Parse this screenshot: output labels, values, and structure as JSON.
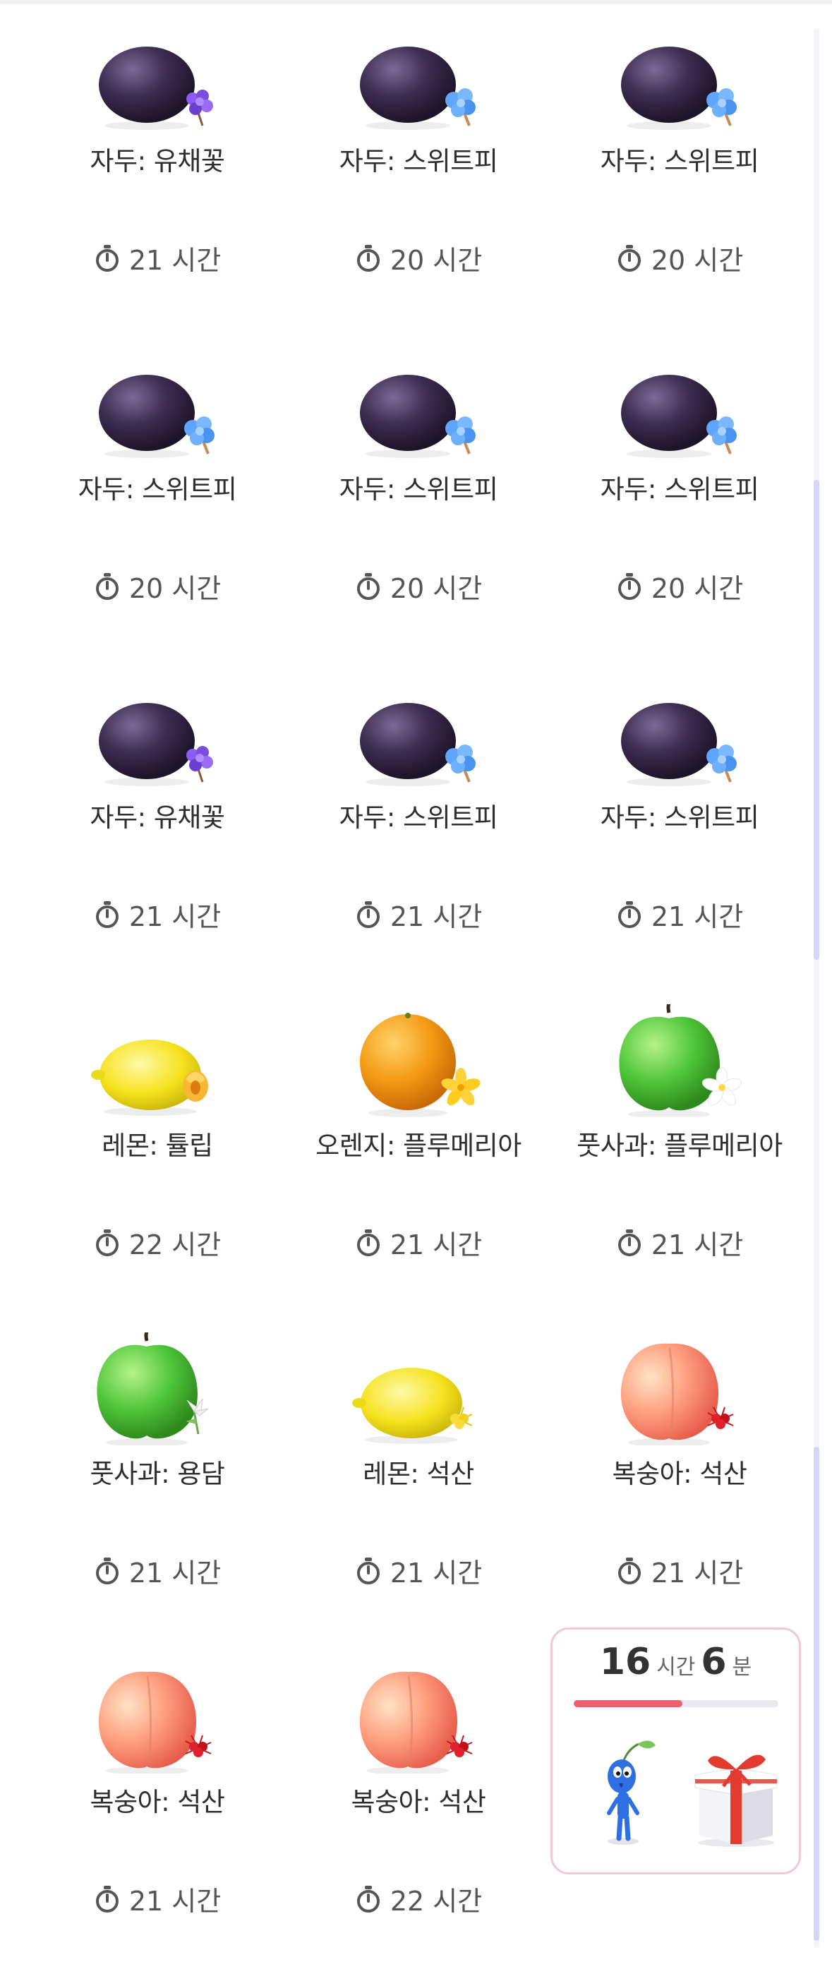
{
  "items": [
    {
      "fruit": "plum",
      "flower": "rapeseed",
      "label": "자두: 유채꽃",
      "time": "21 시간"
    },
    {
      "fruit": "plum",
      "flower": "sweetpea",
      "label": "자두: 스위트피",
      "time": "20 시간"
    },
    {
      "fruit": "plum",
      "flower": "sweetpea",
      "label": "자두: 스위트피",
      "time": "20 시간"
    },
    {
      "fruit": "plum",
      "flower": "sweetpea",
      "label": "자두: 스위트피",
      "time": "20 시간"
    },
    {
      "fruit": "plum",
      "flower": "sweetpea",
      "label": "자두: 스위트피",
      "time": "20 시간"
    },
    {
      "fruit": "plum",
      "flower": "sweetpea",
      "label": "자두: 스위트피",
      "time": "20 시간"
    },
    {
      "fruit": "plum",
      "flower": "rapeseed",
      "label": "자두: 유채꽃",
      "time": "21 시간"
    },
    {
      "fruit": "plum",
      "flower": "sweetpea",
      "label": "자두: 스위트피",
      "time": "21 시간"
    },
    {
      "fruit": "plum",
      "flower": "sweetpea",
      "label": "자두: 스위트피",
      "time": "21 시간"
    },
    {
      "fruit": "lemon",
      "flower": "tulip",
      "label": "레몬: 튤립",
      "time": "22 시간"
    },
    {
      "fruit": "orange",
      "flower": "plumeria-yellow",
      "label": "오렌지: 플루메리아",
      "time": "21 시간"
    },
    {
      "fruit": "green-apple",
      "flower": "plumeria-white",
      "label": "풋사과: 플루메리아",
      "time": "21 시간"
    },
    {
      "fruit": "green-apple",
      "flower": "gentian",
      "label": "풋사과: 용담",
      "time": "21 시간"
    },
    {
      "fruit": "lemon",
      "flower": "lycoris-yellow",
      "label": "레몬: 석산",
      "time": "21 시간"
    },
    {
      "fruit": "peach",
      "flower": "lycoris-red",
      "label": "복숭아: 석산",
      "time": "21 시간"
    },
    {
      "fruit": "peach",
      "flower": "lycoris-red",
      "label": "복숭아: 석산",
      "time": "21 시간"
    },
    {
      "fruit": "peach",
      "flower": "lycoris-red",
      "label": "복숭아: 석산",
      "time": "22 시간"
    }
  ],
  "timer_icon": "stopwatch-icon",
  "widget": {
    "hours": "16",
    "hours_unit": "시간",
    "minutes": "6",
    "minutes_unit": "분",
    "progress": 0.53,
    "character_icon": "blue-pikmin-icon",
    "reward_icon": "gift-box-icon",
    "colors": {
      "bar": "#ef5f6c",
      "border": "#f5c7d3"
    }
  }
}
